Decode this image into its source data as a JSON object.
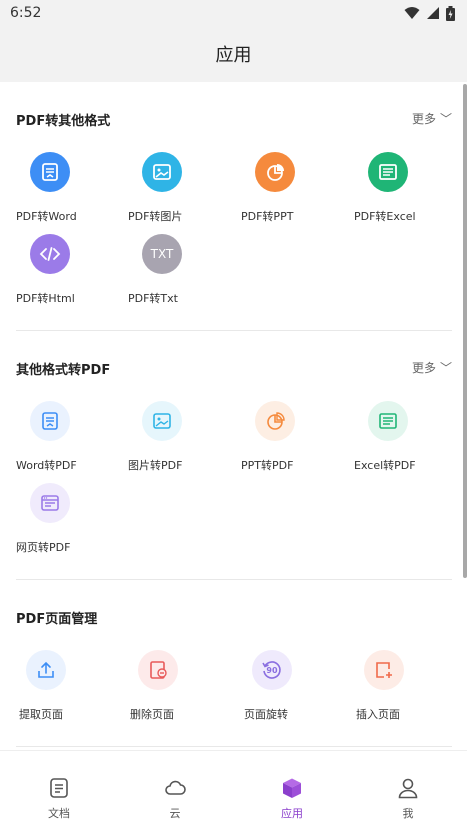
{
  "status": {
    "time": "6:52"
  },
  "header": {
    "title": "应用"
  },
  "sections": [
    {
      "title": "PDF转其他格式",
      "more": "更多",
      "items": [
        {
          "label": "PDF转Word",
          "icon": "word-doc-icon",
          "color": "#3d8ef5"
        },
        {
          "label": "PDF转图片",
          "icon": "image-icon",
          "color": "#2fb4e6"
        },
        {
          "label": "PDF转PPT",
          "icon": "pie-chart-icon",
          "color": "#f58a3d"
        },
        {
          "label": "PDF转Excel",
          "icon": "spreadsheet-icon",
          "color": "#1fb576"
        },
        {
          "label": "PDF转Html",
          "icon": "code-icon",
          "color": "#9b7be8"
        },
        {
          "label": "PDF转Txt",
          "icon": "txt-icon",
          "color": "#a8a4b0",
          "text": "TXT"
        }
      ]
    },
    {
      "title": "其他格式转PDF",
      "more": "更多",
      "items": [
        {
          "label": "Word转PDF",
          "icon": "word-doc-icon",
          "color": "#3d8ef5"
        },
        {
          "label": "图片转PDF",
          "icon": "image-icon",
          "color": "#2fb4e6"
        },
        {
          "label": "PPT转PDF",
          "icon": "pie-chart-icon",
          "color": "#f58a3d"
        },
        {
          "label": "Excel转PDF",
          "icon": "spreadsheet-icon",
          "color": "#1fb576"
        },
        {
          "label": "网页转PDF",
          "icon": "webpage-icon",
          "color": "#9b7be8"
        }
      ]
    },
    {
      "title": "PDF页面管理",
      "items": [
        {
          "label": "提取页面",
          "icon": "extract-icon",
          "color": "#3d8ef5"
        },
        {
          "label": "删除页面",
          "icon": "delete-page-icon",
          "color": "#e85a5a"
        },
        {
          "label": "页面旋转",
          "icon": "rotate-icon",
          "color": "#8a6ee0",
          "text": "90"
        },
        {
          "label": "插入页面",
          "icon": "insert-page-icon",
          "color": "#f06a4a"
        }
      ]
    }
  ],
  "nav": [
    {
      "label": "文档",
      "icon": "document-icon"
    },
    {
      "label": "云",
      "icon": "cloud-icon"
    },
    {
      "label": "应用",
      "icon": "apps-cube-icon",
      "active": true
    },
    {
      "label": "我",
      "icon": "user-icon"
    }
  ]
}
